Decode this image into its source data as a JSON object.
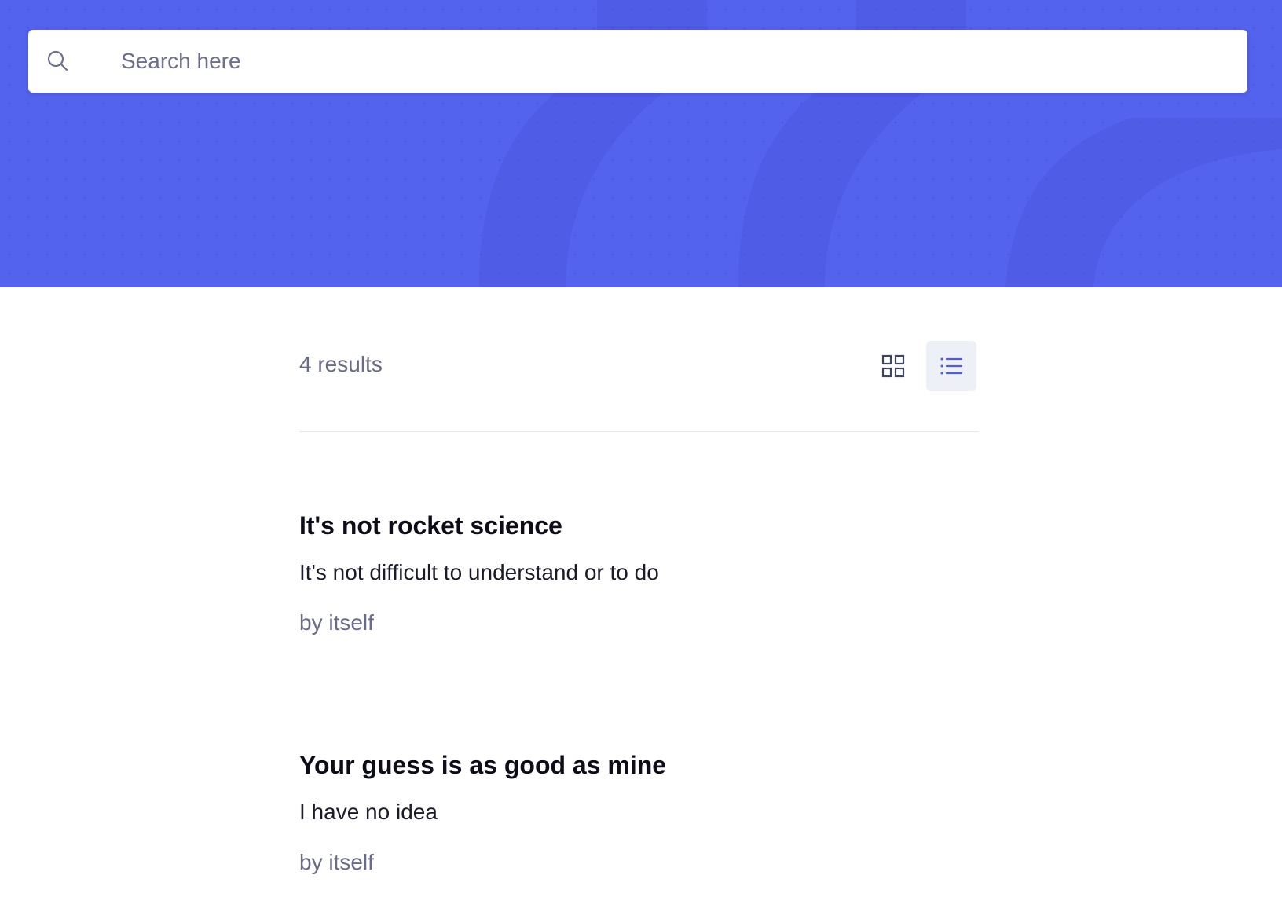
{
  "search": {
    "placeholder": "Search here",
    "value": ""
  },
  "results": {
    "count_label": "4 results",
    "views": [
      {
        "name": "grid",
        "icon": "grid-icon",
        "active": false
      },
      {
        "name": "list",
        "icon": "list-icon",
        "active": true
      }
    ],
    "items": [
      {
        "title": "It's not rocket science",
        "description": "It's not difficult to understand or to do",
        "author": "by itself"
      },
      {
        "title": "Your guess is as good as mine",
        "description": "I have no idea",
        "author": "by itself"
      }
    ]
  },
  "colors": {
    "hero": "#5363ee",
    "accent": "#4f5be0",
    "text_muted": "#6a6a8a"
  }
}
